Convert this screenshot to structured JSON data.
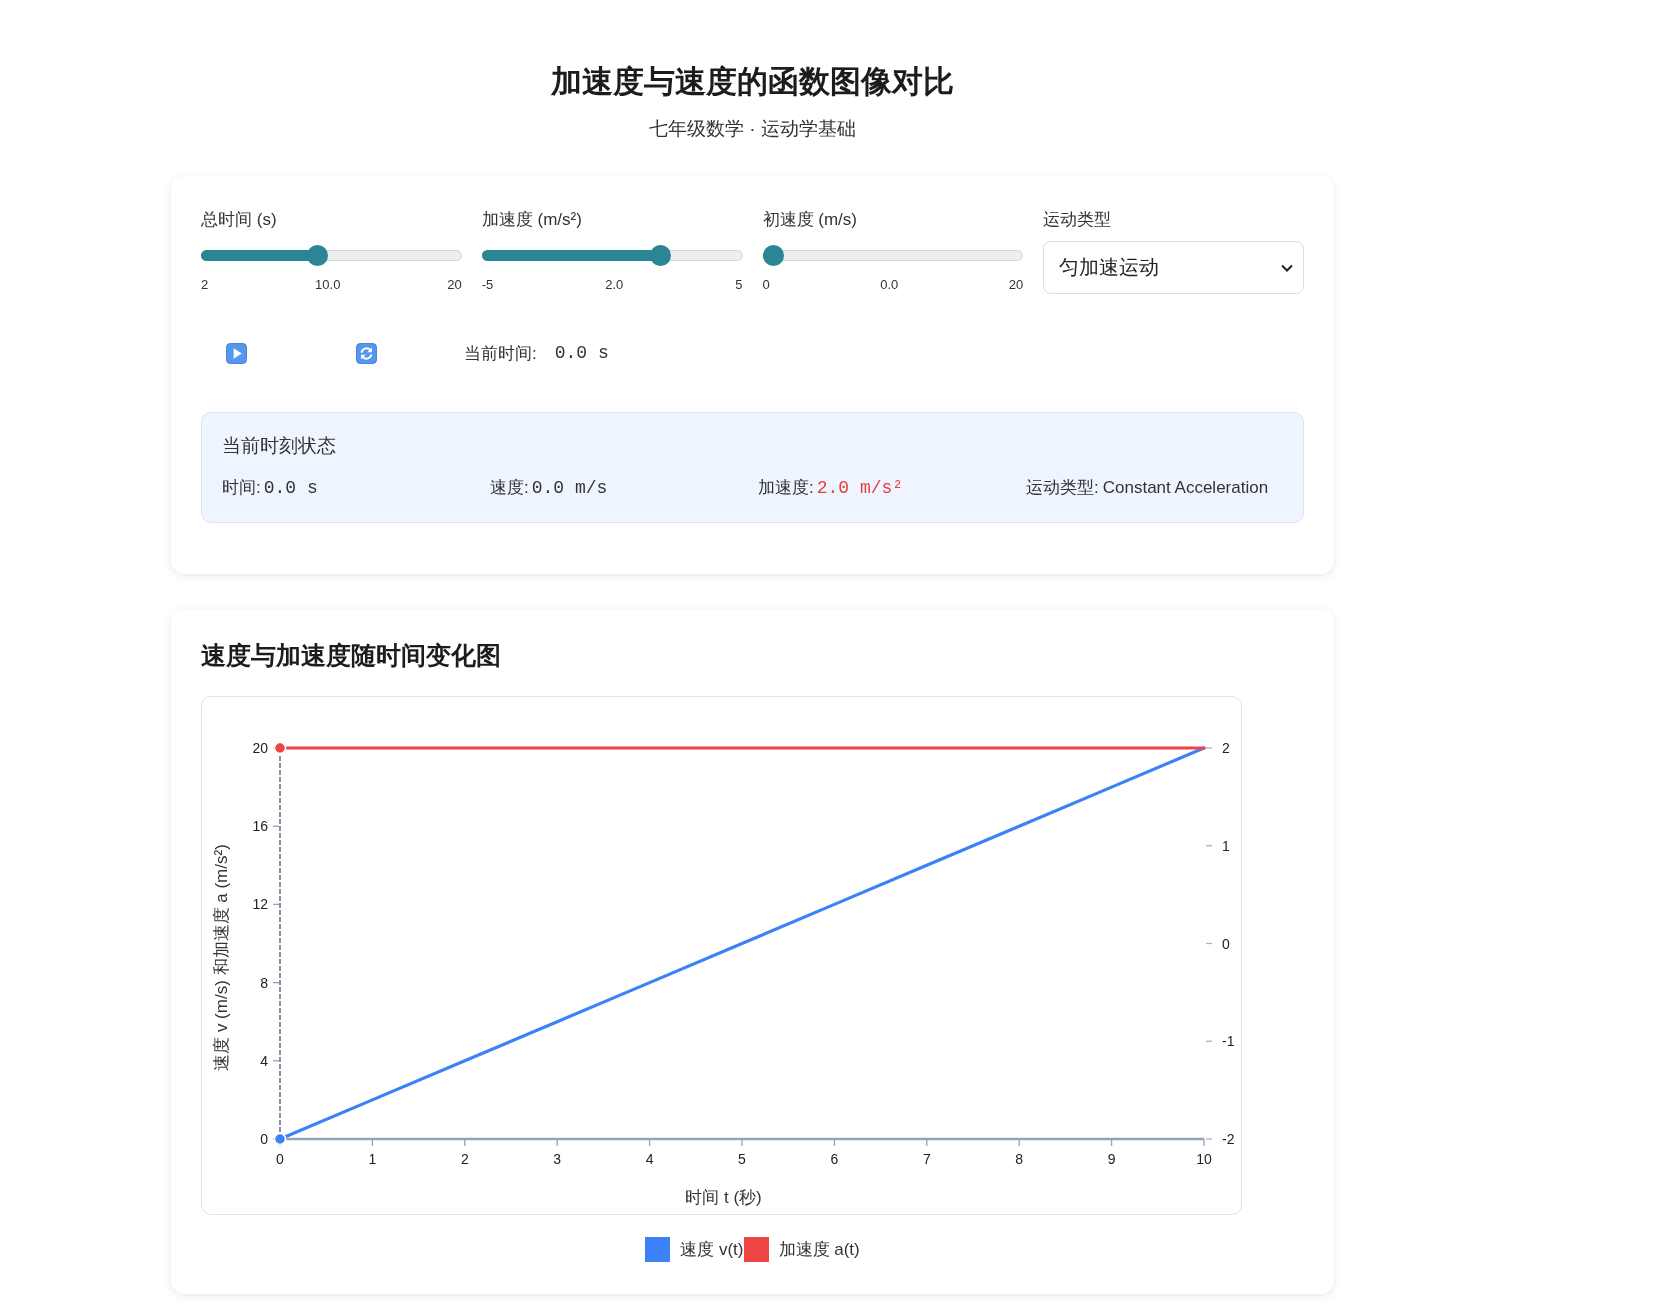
{
  "header": {
    "title": "加速度与速度的函数图像对比",
    "subtitle": "七年级数学 · 运动学基础"
  },
  "controls": [
    {
      "kind": "slider",
      "label": "总时间 (s)",
      "min": "2",
      "value": "10.0",
      "max": "20",
      "level": 0.444
    },
    {
      "kind": "slider",
      "label": "加速度 (m/s²)",
      "min": "-5",
      "value": "2.0",
      "max": "5",
      "level": 0.7
    },
    {
      "kind": "slider",
      "label": "初速度 (m/s)",
      "min": "0",
      "value": "0.0",
      "max": "20",
      "level": 0
    },
    {
      "kind": "select",
      "label": "运动类型",
      "value": "匀加速运动"
    }
  ],
  "playback": {
    "buttons": [
      {
        "kind": "play"
      },
      {
        "kind": "reset"
      }
    ],
    "time_label": "当前时间:",
    "time_value": "0.0 s"
  },
  "status": {
    "title": "当前时刻状态",
    "items": [
      {
        "label": "时间:",
        "value": "0.0 s",
        "kind": "mono",
        "highlighted": false
      },
      {
        "label": "速度:",
        "value": "0.0 m/s",
        "kind": "mono",
        "highlighted": false
      },
      {
        "label": "加速度:",
        "value": "2.0 m/s²",
        "kind": "mono",
        "highlighted": true
      },
      {
        "label": "运动类型:",
        "value": "Constant Acceleration",
        "kind": "text",
        "highlighted": false
      }
    ]
  },
  "chart_card": {
    "title": "速度与加速度随时间变化图",
    "chart_data": {
      "type": "line",
      "xlabel": "时间 t (秒)",
      "ylabel": "速度 v (m/s) 和加速度 a (m/s²)",
      "x": [
        0,
        1,
        2,
        3,
        4,
        5,
        6,
        7,
        8,
        9,
        10
      ],
      "series": [
        {
          "name": "速度 v(t)",
          "color": "#3b82f6",
          "values": [
            0,
            2,
            4,
            6,
            8,
            10,
            12,
            14,
            16,
            18,
            20
          ]
        },
        {
          "name": "加速度 a(t)",
          "color": "#ef4444",
          "axis": "y2",
          "values": [
            2,
            2,
            2,
            2,
            2,
            2,
            2,
            2,
            2,
            2,
            2
          ]
        }
      ],
      "xlim": [
        0,
        10
      ],
      "ylim": [
        0,
        20
      ],
      "y2lim": [
        -2,
        2
      ],
      "xticks": [
        0,
        1,
        2,
        3,
        4,
        5,
        6,
        7,
        8,
        9,
        10
      ],
      "yticks": [
        0,
        4,
        8,
        12,
        16,
        20
      ],
      "y2ticks": [
        -2,
        -1,
        0,
        1,
        2
      ],
      "ref_lines": [
        {
          "axis": "x",
          "value": 0
        }
      ]
    }
  }
}
